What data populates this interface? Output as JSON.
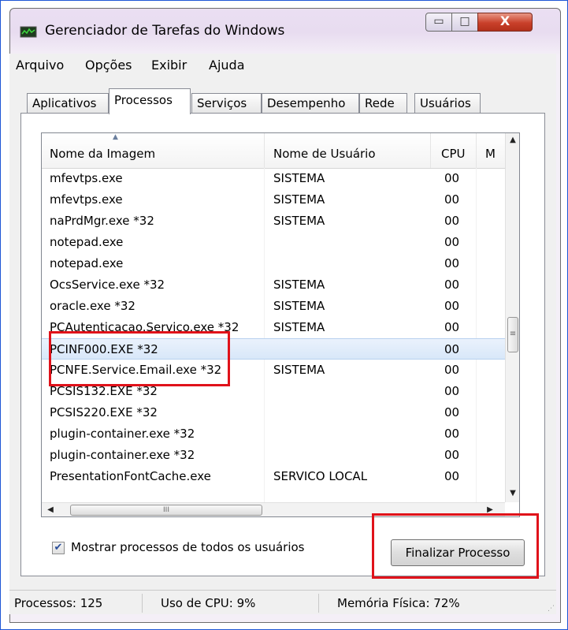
{
  "window": {
    "title": "Gerenciador de Tarefas do Windows",
    "minimize_glyph": "▭",
    "maximize_glyph": "□",
    "close_glyph": "X"
  },
  "menu": [
    "Arquivo",
    "Opções",
    "Exibir",
    "Ajuda"
  ],
  "tabs": [
    "Aplicativos",
    "Processos",
    "Serviços",
    "Desempenho",
    "Rede",
    "Usuários"
  ],
  "active_tab": "Processos",
  "columns": {
    "name": "Nome da Imagem",
    "user": "Nome de Usuário",
    "cpu": "CPU",
    "next": "M"
  },
  "processes": [
    {
      "name": "mfevtps.exe",
      "user": "SISTEMA",
      "cpu": "00"
    },
    {
      "name": "mfevtps.exe",
      "user": "SISTEMA",
      "cpu": "00"
    },
    {
      "name": "naPrdMgr.exe *32",
      "user": "SISTEMA",
      "cpu": "00"
    },
    {
      "name": "notepad.exe",
      "user": "",
      "cpu": "00"
    },
    {
      "name": "notepad.exe",
      "user": "",
      "cpu": "00"
    },
    {
      "name": "OcsService.exe *32",
      "user": "SISTEMA",
      "cpu": "00"
    },
    {
      "name": "oracle.exe *32",
      "user": "SISTEMA",
      "cpu": "00"
    },
    {
      "name": "PCAutenticacao.Servico.exe *32",
      "user": "SISTEMA",
      "cpu": "00"
    },
    {
      "name": "PCINF000.EXE *32",
      "user": "",
      "cpu": "00"
    },
    {
      "name": "PCNFE.Service.Email.exe *32",
      "user": "SISTEMA",
      "cpu": "00"
    },
    {
      "name": "PCSIS132.EXE *32",
      "user": "",
      "cpu": "00"
    },
    {
      "name": "PCSIS220.EXE *32",
      "user": "",
      "cpu": "00"
    },
    {
      "name": "plugin-container.exe *32",
      "user": "",
      "cpu": "00"
    },
    {
      "name": "plugin-container.exe *32",
      "user": "",
      "cpu": "00"
    },
    {
      "name": "PresentationFontCache.exe",
      "user": "SERVICO LOCAL",
      "cpu": "00"
    }
  ],
  "selected_process": "PCINF000.EXE *32",
  "show_all_users": {
    "label": "Mostrar processos de todos os usuários",
    "checked": true
  },
  "end_process_button": "Finalizar Processo",
  "status": {
    "processes": "Processos: 125",
    "cpu": "Uso de CPU: 9%",
    "memory": "Memória Física: 72%"
  },
  "annotation_color": "#e0121a",
  "glyphs": {
    "sort_up": "▲",
    "scroll_up": "▲",
    "scroll_down": "▼",
    "scroll_left": "◀",
    "scroll_right": "▶",
    "thumb_grip_v": "≡",
    "thumb_grip_h": "III",
    "check": "✔",
    "grip": "⋰"
  }
}
